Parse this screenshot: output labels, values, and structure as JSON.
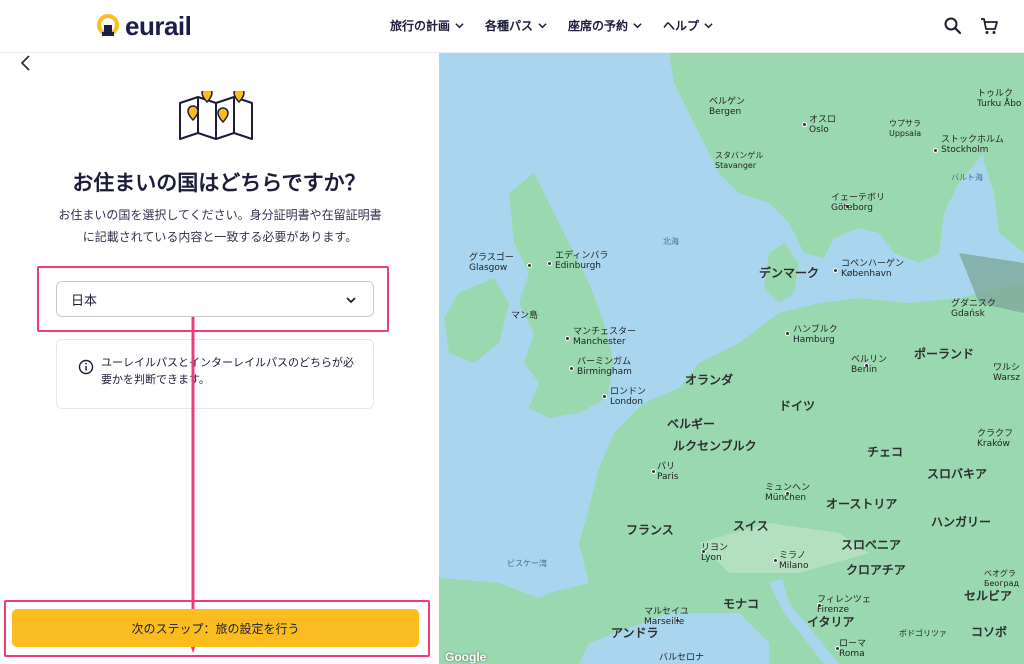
{
  "header": {
    "logo_text": "eurail",
    "nav": [
      {
        "label": "旅行の計画"
      },
      {
        "label": "各種パス"
      },
      {
        "label": "座席の予約"
      },
      {
        "label": "ヘルプ"
      }
    ]
  },
  "panel": {
    "title": "お住まいの国はどちらですか？",
    "description": "お住まいの国を選択してください。身分証明書や在留証明書に記載されている内容と一致する必要があります。",
    "country_select": {
      "value": "日本"
    },
    "info": "ユーレイルパスとインターレイルパスのどちらが必要かを判断できます。",
    "next_button": "次のステップ：旅の設定を行う"
  },
  "map": {
    "countries": [
      "デンマーク",
      "オランダ",
      "ドイツ",
      "ベルギー",
      "ルクセンブルク",
      "フランス",
      "スイス",
      "チェコ",
      "ポーランド",
      "オーストリア",
      "スロバキア",
      "ハンガリー",
      "スロベニア",
      "クロアチア",
      "イタリア",
      "モナコ",
      "アンドラ",
      "セルビア",
      "コソボ"
    ],
    "seas": [
      "北海",
      "バルト海",
      "ビスケー湾"
    ],
    "cities": [
      {
        "jp": "ベルゲン",
        "en": "Bergen"
      },
      {
        "jp": "オスロ",
        "en": "Oslo"
      },
      {
        "jp": "スタバンゲル",
        "en": "Stavanger"
      },
      {
        "jp": "ウプサラ",
        "en": "Uppsala"
      },
      {
        "jp": "トゥルク",
        "en": "Turku Åbo"
      },
      {
        "jp": "ストックホルム",
        "en": "Stockholm"
      },
      {
        "jp": "イェーテボリ",
        "en": "Göteborg"
      },
      {
        "jp": "グラスゴー",
        "en": "Glasgow"
      },
      {
        "jp": "エディンバラ",
        "en": "Edinburgh"
      },
      {
        "jp": "コペンハーゲン",
        "en": "København"
      },
      {
        "jp": "グダニスク",
        "en": "Gdańsk"
      },
      {
        "jp": "マン島",
        "en": ""
      },
      {
        "jp": "マンチェスター",
        "en": "Manchester"
      },
      {
        "jp": "ハンブルク",
        "en": "Hamburg"
      },
      {
        "jp": "バーミンガム",
        "en": "Birmingham"
      },
      {
        "jp": "ベルリン",
        "en": "Berlin"
      },
      {
        "jp": "ロンドン",
        "en": "London"
      },
      {
        "jp": "ワルシ",
        "en": "Warsz"
      },
      {
        "jp": "クラクフ",
        "en": "Kraków"
      },
      {
        "jp": "パリ",
        "en": "Paris"
      },
      {
        "jp": "ミュンヘン",
        "en": "München"
      },
      {
        "jp": "リヨン",
        "en": "Lyon"
      },
      {
        "jp": "ミラノ",
        "en": "Milano"
      },
      {
        "jp": "ベオグラ",
        "en": "Београд"
      },
      {
        "jp": "マルセイユ",
        "en": "Marseille"
      },
      {
        "jp": "フィレンツェ",
        "en": "Firenze"
      },
      {
        "jp": "ボドゴリツァ",
        "en": ""
      },
      {
        "jp": "ローマ",
        "en": "Roma"
      },
      {
        "jp": "バルセロナ",
        "en": ""
      }
    ],
    "attribution": "Google"
  }
}
